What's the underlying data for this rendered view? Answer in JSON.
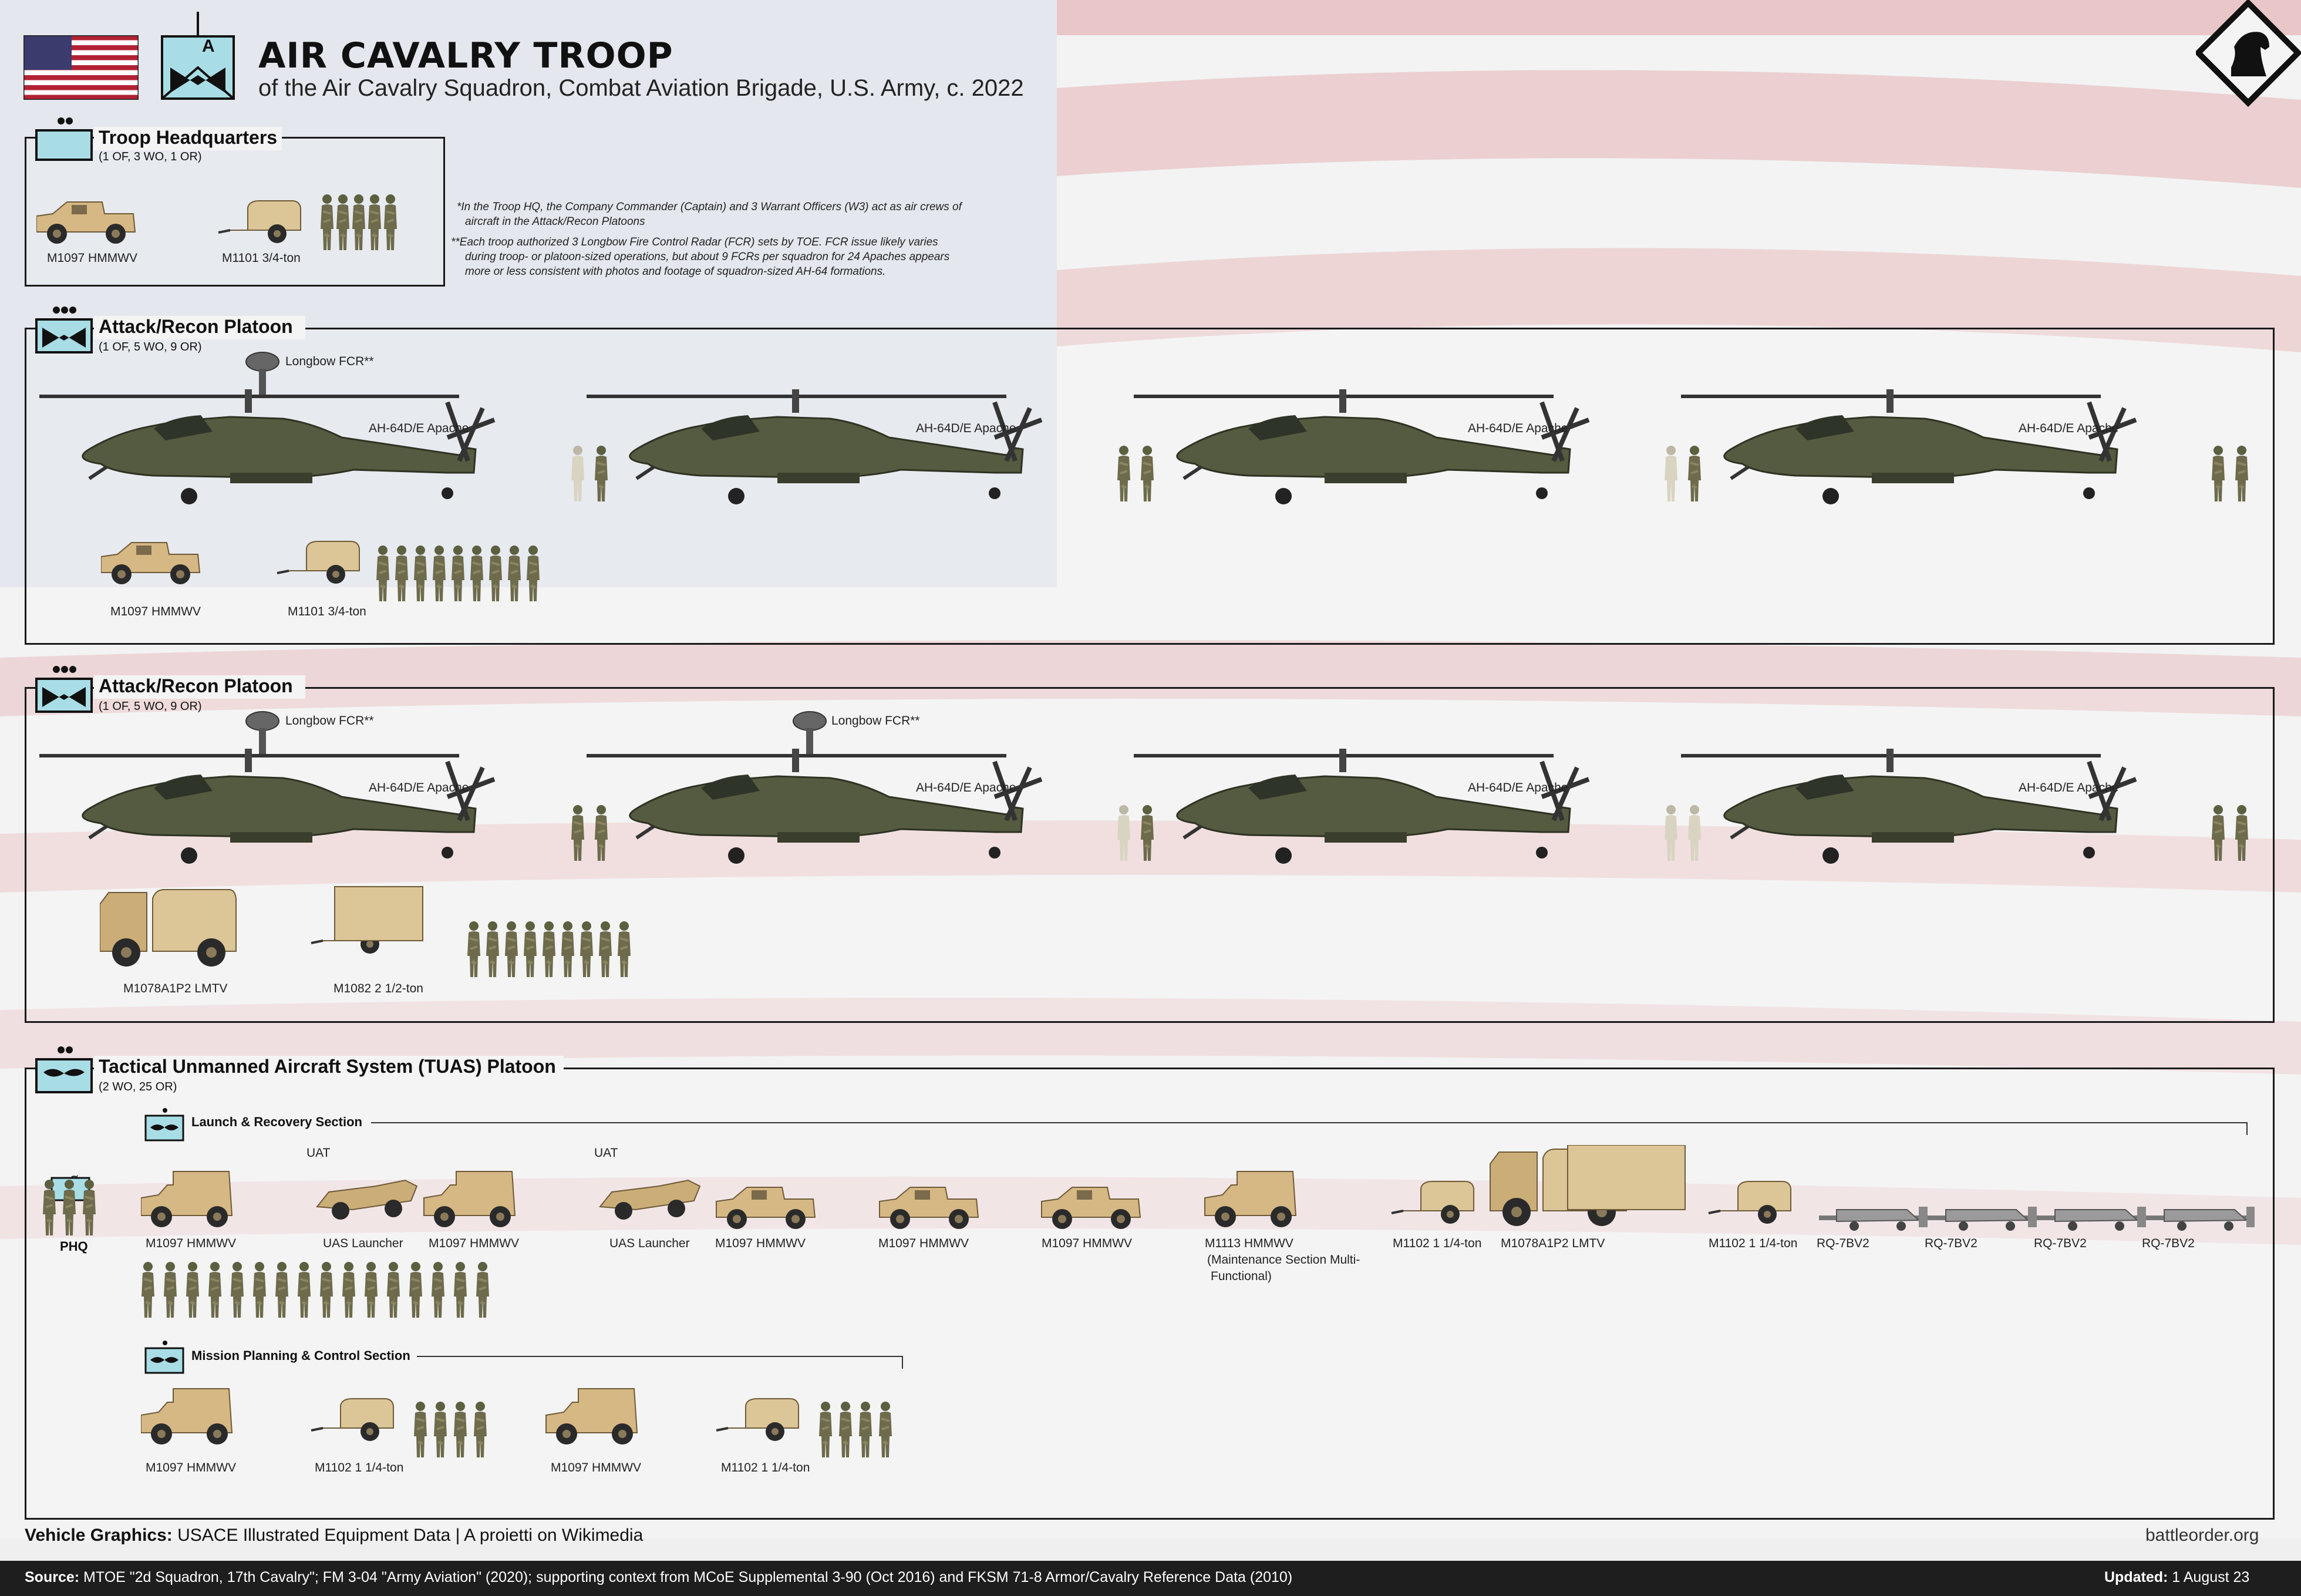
{
  "header": {
    "title": "AIR CAVALRY TROOP",
    "subtitle": "of the Air Cavalry Squadron, Combat Aviation Brigade, U.S. Army, c. 2022",
    "unit_symbol_letter": "A",
    "flag_icon": "us-flag-icon",
    "logo_icon": "knight-logo-icon"
  },
  "notes": {
    "line1": "*In the Troop HQ, the Company Commander (Captain) and 3 Warrant Officers (W3) act as air crews of",
    "line2": "aircraft in the Attack/Recon Platoons",
    "line3": "**Each troop authorized 3 Longbow Fire Control Radar (FCR) sets by TOE. FCR issue likely varies",
    "line4": "during troop- or platoon-sized operations, but about 9 FCRs per squadron for 24 Apaches appears",
    "line5": "more or less consistent with photos and footage of squadron-sized AH-64 formations."
  },
  "hq": {
    "title": "Troop Headquarters",
    "strength": "(1 OF, 3 WO, 1 OR)",
    "vehicle1": "M1097 HMMWV",
    "vehicle2": "M1101 3/4-ton"
  },
  "platoon1": {
    "title": "Attack/Recon Platoon",
    "strength": "(1 OF, 5 WO, 9 OR)",
    "fcr": "Longbow FCR**",
    "heli": "AH-64D/E Apache",
    "vehicle1": "M1097 HMMWV",
    "vehicle2": "M1101 3/4-ton"
  },
  "platoon2": {
    "title": "Attack/Recon Platoon",
    "strength": "(1 OF, 5 WO, 9 OR)",
    "fcr": "Longbow FCR**",
    "heli": "AH-64D/E Apache",
    "vehicle1": "M1078A1P2 LMTV",
    "vehicle2": "M1082 2 1/2-ton"
  },
  "tuas": {
    "title": "Tactical Unmanned Aircraft System (TUAS) Platoon",
    "strength": "(2 WO, 25 OR)",
    "lrs": "Launch & Recovery Section",
    "mpcs": "Mission Planning & Control Section",
    "phq": "PHQ",
    "phq_mark": "ø",
    "uat": "UAT",
    "hmmwv": "M1097 HMMWV",
    "launcher": "UAS Launcher",
    "m1113": "M1113 HMMWV",
    "m1113_b": "(Maintenance Section Multi-",
    "m1113_c": "Functional)",
    "m1102": "M1102 1 1/4-ton",
    "lmtv": "M1078A1P2 LMTV",
    "rq7": "RQ-7BV2"
  },
  "footer": {
    "graphics_label": "Vehicle Graphics:",
    "graphics_text": "USACE Illustrated Equipment Data  |  A proietti on Wikimedia",
    "site": "battleorder.org",
    "source_label": "Source:",
    "source_text": "MTOE \"2d Squadron, 17th Cavalry\"; FM 3-04 \"Army Aviation\" (2020); supporting context from MCoE Supplemental 3-90 (Oct 2016) and FKSM 71-8 Armor/Cavalry Reference Data (2010)",
    "updated_label": "Updated:",
    "updated_text": "1  August 23"
  },
  "colors": {
    "olive": "#4a5238",
    "tan": "#d9bd8a",
    "symbol_fill": "#a8dde6",
    "footer_bg": "#1e1e1e"
  }
}
